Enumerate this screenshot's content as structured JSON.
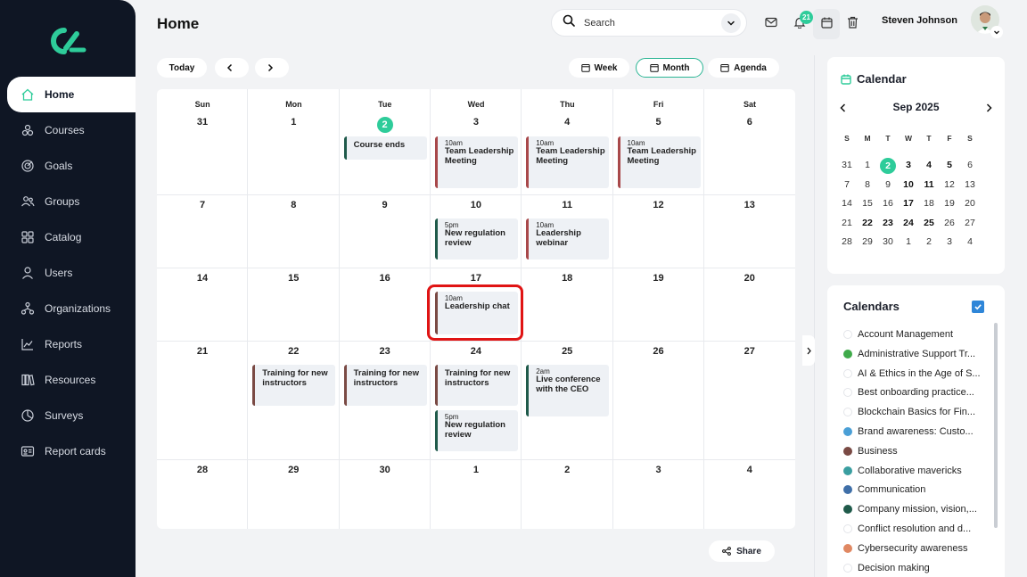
{
  "sidebar": {
    "items": [
      {
        "label": "Home",
        "icon": "home-icon",
        "active": true
      },
      {
        "label": "Courses",
        "icon": "courses-icon"
      },
      {
        "label": "Goals",
        "icon": "goals-icon"
      },
      {
        "label": "Groups",
        "icon": "groups-icon"
      },
      {
        "label": "Catalog",
        "icon": "catalog-icon"
      },
      {
        "label": "Users",
        "icon": "users-icon"
      },
      {
        "label": "Organizations",
        "icon": "organizations-icon"
      },
      {
        "label": "Reports",
        "icon": "reports-icon"
      },
      {
        "label": "Resources",
        "icon": "resources-icon"
      },
      {
        "label": "Surveys",
        "icon": "surveys-icon"
      },
      {
        "label": "Report cards",
        "icon": "report-cards-icon"
      }
    ]
  },
  "header": {
    "title": "Home",
    "search_placeholder": "Search",
    "notification_count": "21",
    "user_name": "Steven Johnson"
  },
  "toolbar": {
    "today": "Today",
    "views": [
      "Week",
      "Month",
      "Agenda"
    ],
    "selected_view": "Month"
  },
  "calendar": {
    "weekdays": [
      "Sun",
      "Mon",
      "Tue",
      "Wed",
      "Thu",
      "Fri",
      "Sat"
    ],
    "weeks": [
      [
        "31",
        "1",
        "2",
        "3",
        "4",
        "5",
        "6"
      ],
      [
        "7",
        "8",
        "9",
        "10",
        "11",
        "12",
        "13"
      ],
      [
        "14",
        "15",
        "16",
        "17",
        "18",
        "19",
        "20"
      ],
      [
        "21",
        "22",
        "23",
        "24",
        "25",
        "26",
        "27"
      ],
      [
        "28",
        "29",
        "30",
        "1",
        "2",
        "3",
        "4"
      ]
    ],
    "today": "2",
    "events": {
      "course_ends": {
        "title": "Course ends"
      },
      "team_wed": {
        "time": "10am",
        "title": "Team Leadership Meeting"
      },
      "team_thu": {
        "time": "10am",
        "title": "Team Leadership Meeting"
      },
      "team_fri": {
        "time": "10am",
        "title": "Team Leadership Meeting"
      },
      "reg_review_10": {
        "time": "5pm",
        "title": "New regulation review"
      },
      "webinar_11": {
        "time": "10am",
        "title": "Leadership webinar"
      },
      "chat_17": {
        "time": "10am",
        "title": "Leadership chat"
      },
      "training_22": {
        "title": "Training for new instructors"
      },
      "training_23": {
        "title": "Training for new instructors"
      },
      "training_24": {
        "title": "Training for new instructors"
      },
      "reg_review_24": {
        "time": "5pm",
        "title": "New regulation review"
      },
      "conference_25": {
        "time": "2am",
        "title": "Live conference with the CEO"
      }
    },
    "share": "Share"
  },
  "mini_calendar": {
    "title": "Calendar",
    "month": "Sep 2025",
    "weekdays": [
      "S",
      "M",
      "T",
      "W",
      "T",
      "F",
      "S"
    ],
    "rows": [
      [
        "31",
        "1",
        "2",
        "3",
        "4",
        "5",
        "6"
      ],
      [
        "7",
        "8",
        "9",
        "10",
        "11",
        "12",
        "13"
      ],
      [
        "14",
        "15",
        "16",
        "17",
        "18",
        "19",
        "20"
      ],
      [
        "21",
        "22",
        "23",
        "24",
        "25",
        "26",
        "27"
      ],
      [
        "28",
        "29",
        "30",
        "1",
        "2",
        "3",
        "4"
      ]
    ]
  },
  "calendars": {
    "title": "Calendars",
    "items": [
      {
        "label": "Account Management",
        "color": "#ffffff"
      },
      {
        "label": "Administrative Support Tr...",
        "color": "#3faa4a"
      },
      {
        "label": "AI & Ethics in the Age of S...",
        "color": "#ffffff"
      },
      {
        "label": "Best onboarding practice...",
        "color": "#ffffff"
      },
      {
        "label": "Blockchain Basics for Fin...",
        "color": "#ffffff"
      },
      {
        "label": "Brand awareness: Custo...",
        "color": "#4a9fd6"
      },
      {
        "label": "Business",
        "color": "#7a4a44"
      },
      {
        "label": "Collaborative mavericks",
        "color": "#3a9ea0"
      },
      {
        "label": "Communication",
        "color": "#3f6fa8"
      },
      {
        "label": "Company mission, vision,...",
        "color": "#1f5a4a"
      },
      {
        "label": "Conflict resolution and d...",
        "color": "#ffffff"
      },
      {
        "label": "Cybersecurity awareness",
        "color": "#e08862"
      },
      {
        "label": "Decision making",
        "color": "#ffffff"
      }
    ]
  },
  "colors": {
    "accent": "#2ecc9a",
    "sidebar_bg": "#0f1624",
    "event_bar_green": "#1f5a4a",
    "event_bar_red": "#a8484a",
    "event_bar_brown": "#7a4a44",
    "highlight": "#e01414"
  }
}
